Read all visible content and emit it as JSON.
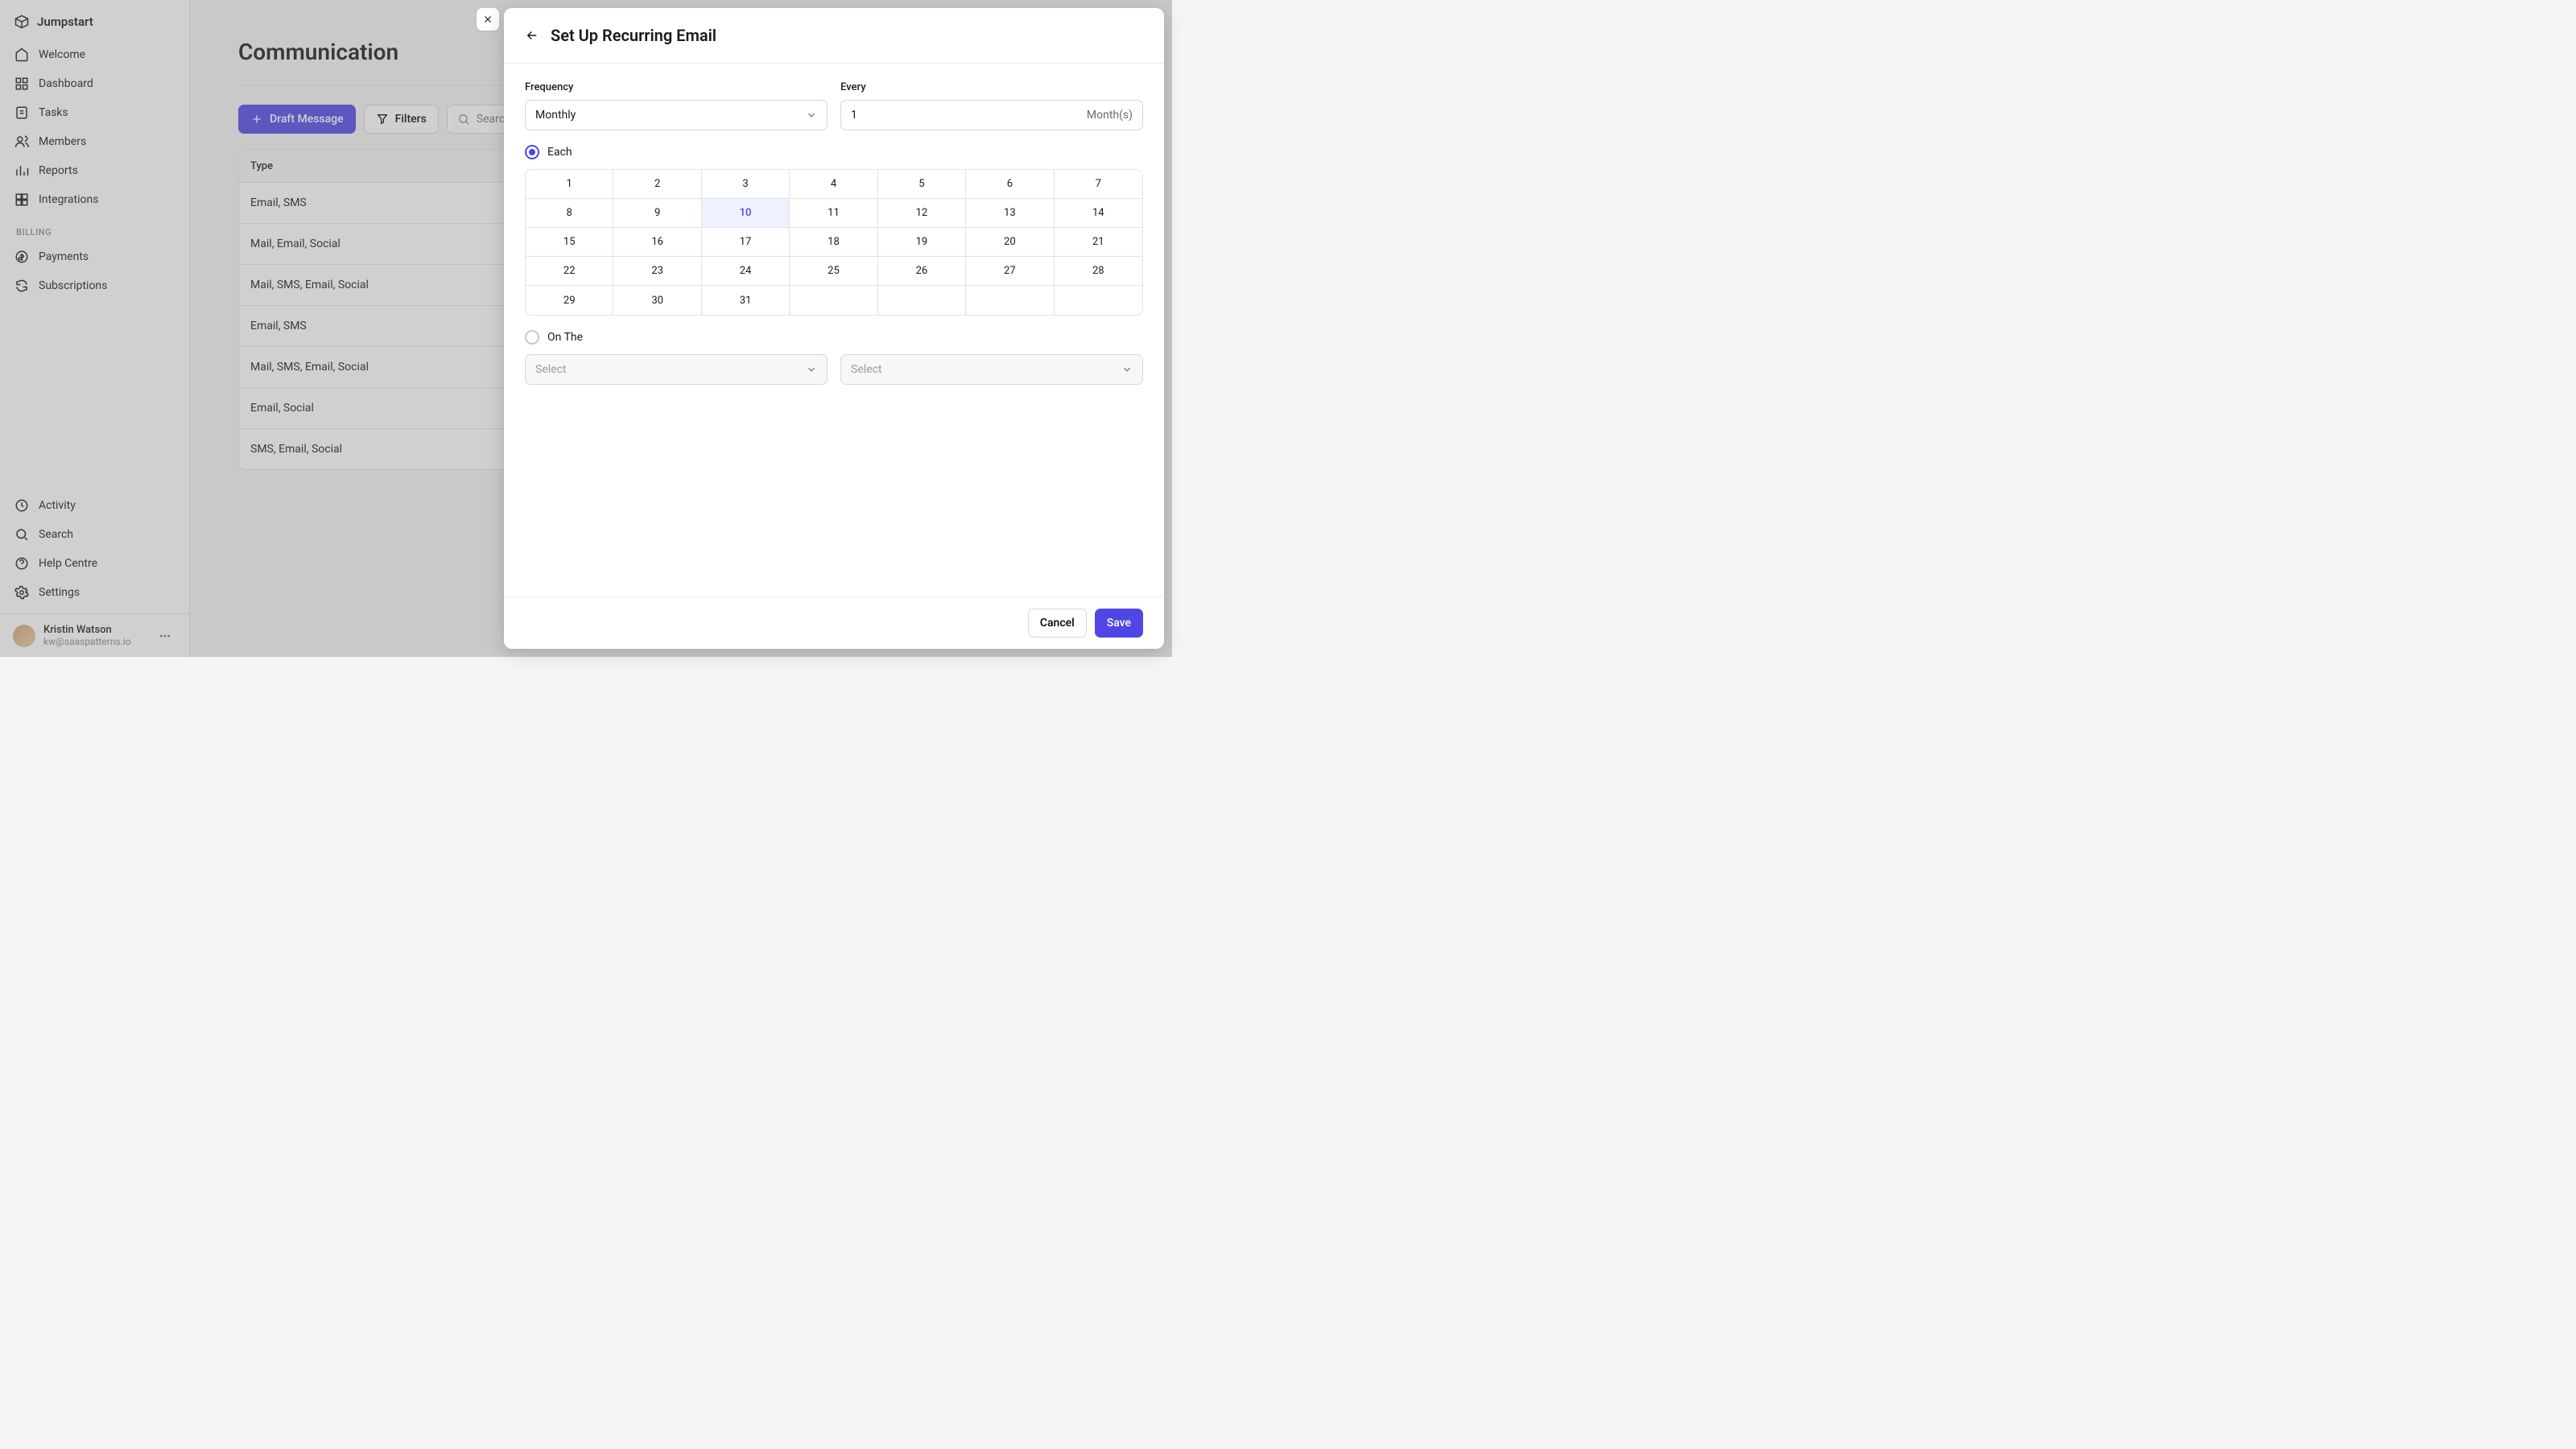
{
  "brand": "Jumpstart",
  "nav": {
    "main": [
      "Welcome",
      "Dashboard",
      "Tasks",
      "Members",
      "Reports",
      "Integrations"
    ],
    "billing_header": "BILLING",
    "billing": [
      "Payments",
      "Subscriptions"
    ],
    "bottom": [
      "Activity",
      "Search",
      "Help Centre",
      "Settings"
    ]
  },
  "user": {
    "name": "Kristin Watson",
    "email": "kw@saaspatterns.io"
  },
  "page": {
    "title": "Communication",
    "draft_btn": "Draft Message",
    "filters_btn": "Filters",
    "search_placeholder": "Search",
    "table_header": "Type",
    "rows": [
      "Email, SMS",
      "Mail, Email, Social",
      "Mail, SMS, Email, Social",
      "Email, SMS",
      "Mail, SMS, Email, Social",
      "Email, Social",
      "SMS, Email, Social"
    ]
  },
  "drawer": {
    "title": "Set Up Recurring Email",
    "frequency_label": "Frequency",
    "frequency_value": "Monthly",
    "every_label": "Every",
    "every_value": "1",
    "every_unit": "Month(s)",
    "radio_each": "Each",
    "radio_onthe": "On The",
    "selected_day": 10,
    "select_placeholder": "Select",
    "cancel": "Cancel",
    "save": "Save"
  }
}
